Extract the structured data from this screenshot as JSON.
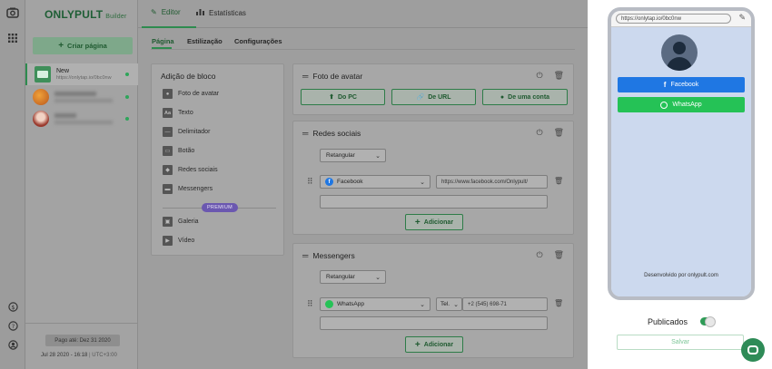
{
  "brand": {
    "name": "ONLYPULT",
    "suffix": "Builder"
  },
  "sidebar": {
    "create_label": "Criar página",
    "pages": [
      {
        "name": "New",
        "url": "https://onlytap.io/0bc0nw"
      },
      {
        "name": "",
        "url": ""
      },
      {
        "name": "",
        "url": ""
      }
    ],
    "paid_until": "Pago até: Dez 31 2020",
    "datetime": "Jul 28 2020 - 16:18",
    "timezone": "UTC+3:00"
  },
  "topnav": {
    "editor": "Editor",
    "stats": "Estatísticas"
  },
  "subtabs": {
    "page": "Página",
    "styling": "Estilização",
    "settings": "Configurações"
  },
  "blocks": {
    "title": "Adição de bloco",
    "items": [
      "Foto de avatar",
      "Texto",
      "Delimitador",
      "Botão",
      "Redes sociais",
      "Messengers"
    ],
    "premium_badge": "PREMIUM",
    "premium_items": [
      "Galeria",
      "Vídeo"
    ]
  },
  "avatar_card": {
    "title": "Foto de avatar",
    "buttons": [
      "Do PC",
      "De URL",
      "De uma conta"
    ]
  },
  "social_card": {
    "title": "Redes sociais",
    "shape": "Retangular",
    "network": "Facebook",
    "url": "https://www.facebook.com/Onlypult/",
    "extra": "",
    "add_label": "Adicionar"
  },
  "messengers_card": {
    "title": "Messengers",
    "shape": "Retangular",
    "messenger": "WhatsApp",
    "field_type": "Tel.",
    "phone": "+2 (545) 698-71",
    "extra": "",
    "add_label": "Adicionar"
  },
  "preview": {
    "url": "https://onlytap.io/0bc0nw",
    "facebook_label": "Facebook",
    "whatsapp_label": "WhatsApp",
    "credit": "Desenvolvido por onlypult.com",
    "published_label": "Publicados",
    "published": true,
    "save_label": "Salvar"
  },
  "colors": {
    "accent": "#2e8b4f",
    "facebook": "#1f77e3",
    "whatsapp": "#25c256",
    "premium": "#6b58b0"
  }
}
